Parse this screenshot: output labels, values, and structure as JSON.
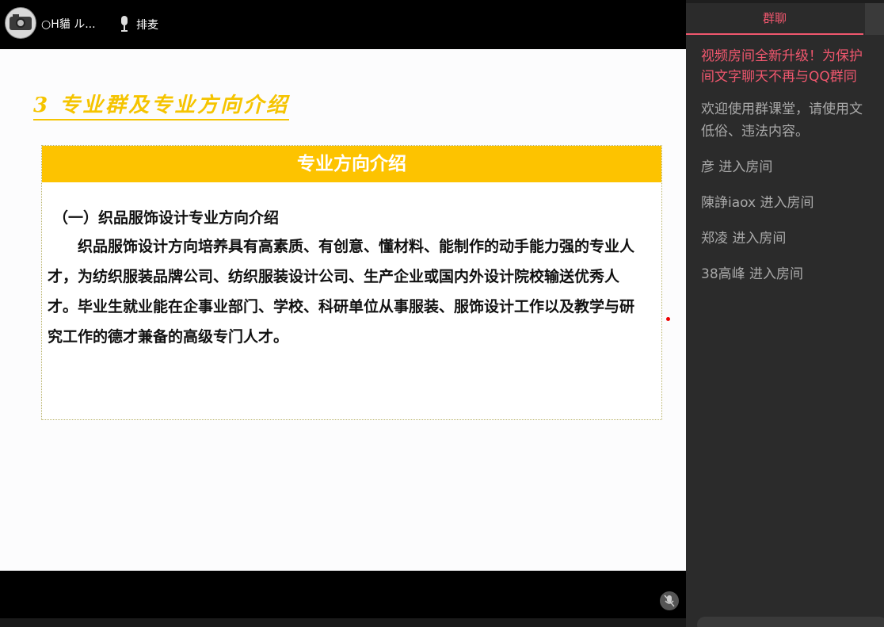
{
  "header": {
    "username": "○H貓 ル...",
    "queue_label": "排麦"
  },
  "slide": {
    "heading": "3 专业群及专业方向介绍",
    "box_title": "专业方向介绍",
    "subtitle": "（一）织品服饰设计专业方向介绍",
    "body": "织品服饰设计方向培养具有高素质、有创意、懂材料、能制作的动手能力强的专业人才，为纺织服装品牌公司、纺织服装设计公司、生产企业或国内外设计院校输送优秀人才。毕业生就业能在企事业部门、学校、科研单位从事服装、服饰设计工作以及教学与研究工作的德才兼备的高级专门人才。"
  },
  "chat": {
    "tab_label": "群聊",
    "notice_lines": [
      "视频房间全新升级！为保护",
      "间文字聊天不再与QQ群同"
    ],
    "welcome_lines": [
      "欢迎使用群课堂，请使用文",
      "低俗、违法内容。"
    ],
    "join_messages": [
      "彦 进入房间",
      "陳諍iaox 进入房间",
      "郑凌 进入房间",
      "38高峰 进入房间"
    ]
  },
  "colors": {
    "accent_pink": "#f0576e",
    "slide_yellow": "#fdc300",
    "panel_bg": "#2b2b2b"
  },
  "icons": [
    "camera-avatar-icon",
    "microphone-icon",
    "mic-muted-icon"
  ]
}
